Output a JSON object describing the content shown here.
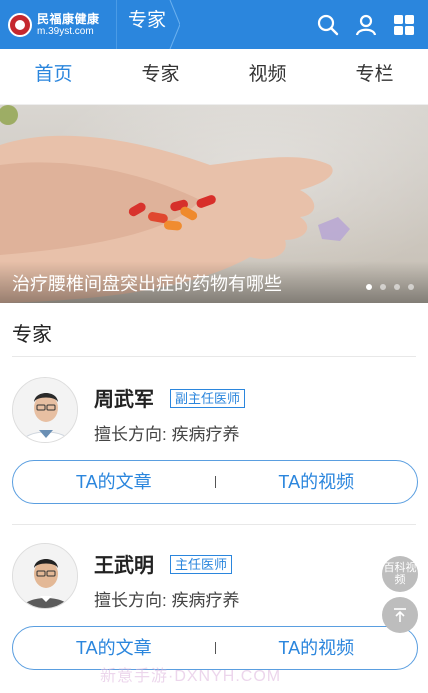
{
  "header": {
    "logo_cn": "民福康健康",
    "logo_en": "m.39yst.com",
    "title": "专家",
    "icons": [
      "search-icon",
      "user-icon",
      "grid-icon"
    ],
    "bg_color": "#2b86dd"
  },
  "tabs": [
    {
      "label": "首页",
      "active": true
    },
    {
      "label": "专家",
      "active": false
    },
    {
      "label": "视频",
      "active": false
    },
    {
      "label": "专栏",
      "active": false
    }
  ],
  "banner": {
    "title": "治疗腰椎间盘突出症的药物有哪些",
    "slide_count": 4,
    "active_slide": 1
  },
  "section": {
    "title": "专家"
  },
  "experts": [
    {
      "name": "周武军",
      "title_badge": "副主任医师",
      "specialty": "擅长方向: 疾病疗养",
      "articles_label": "TA的文章",
      "videos_label": "TA的视频"
    },
    {
      "name": "王武明",
      "title_badge": "主任医师",
      "specialty": "擅长方向: 疾病疗养",
      "articles_label": "TA的文章",
      "videos_label": "TA的视频"
    }
  ],
  "floating": {
    "encyclopedia_video": "百科视频",
    "top_icon": "arrow-up-icon"
  },
  "watermark": "新意手游·DXNYH.COM"
}
